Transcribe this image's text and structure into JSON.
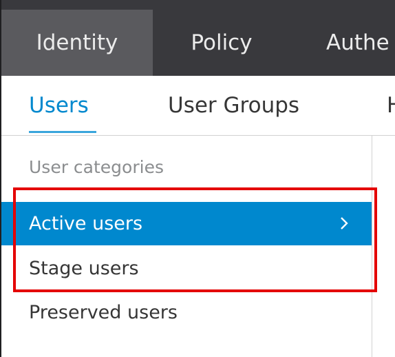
{
  "topnav": {
    "tabs": [
      {
        "label": "Identity",
        "active": true
      },
      {
        "label": "Policy",
        "active": false
      },
      {
        "label": "Authe",
        "active": false
      }
    ]
  },
  "subnav": {
    "tabs": [
      {
        "label": "Users",
        "active": true
      },
      {
        "label": "User Groups",
        "active": false
      },
      {
        "label": "H",
        "active": false
      }
    ]
  },
  "sidebar": {
    "heading": "User categories",
    "items": [
      {
        "label": "Active users",
        "selected": true
      },
      {
        "label": "Stage users",
        "selected": false
      },
      {
        "label": "Preserved users",
        "selected": false
      }
    ]
  },
  "colors": {
    "topnav_bg": "#39393d",
    "topnav_active": "#5a5a5e",
    "accent": "#0088ce",
    "highlight": "#e40000"
  }
}
